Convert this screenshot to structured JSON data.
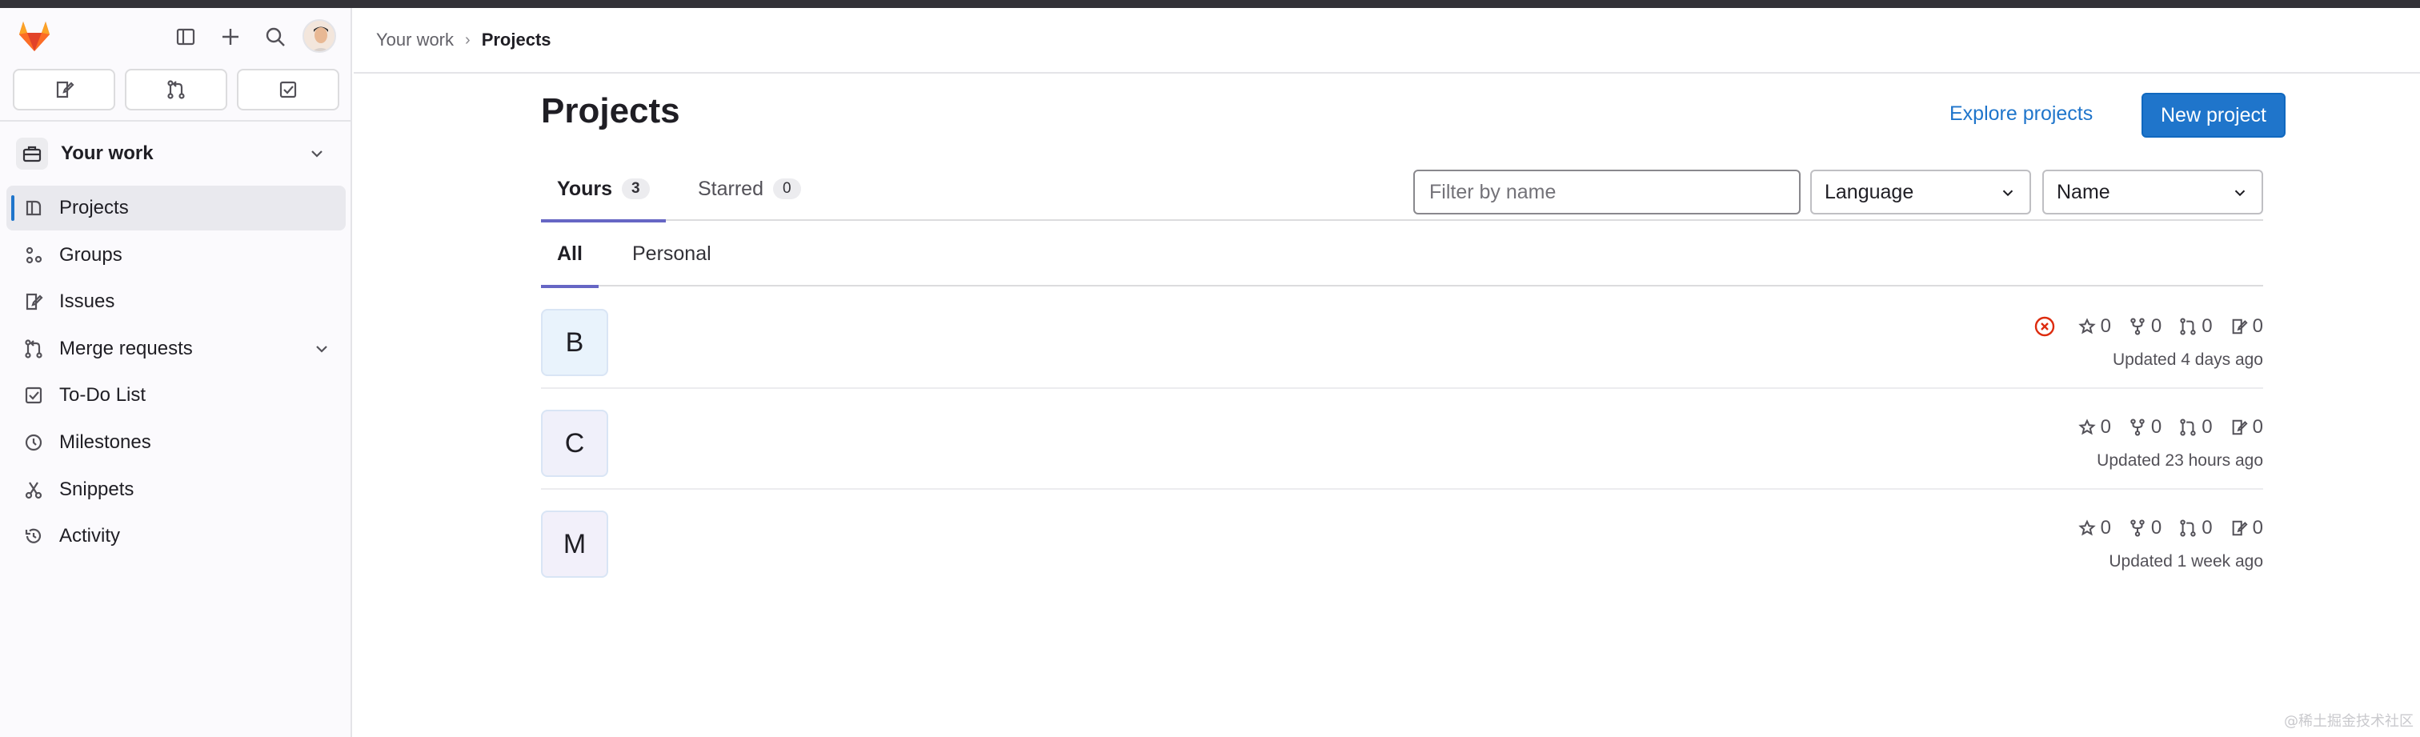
{
  "sidebar": {
    "context_label": "Your work",
    "items": [
      {
        "label": "Projects",
        "icon": "project-icon",
        "active": true
      },
      {
        "label": "Groups",
        "icon": "group-icon"
      },
      {
        "label": "Issues",
        "icon": "issues-icon"
      },
      {
        "label": "Merge requests",
        "icon": "merge-request-icon",
        "expandable": true
      },
      {
        "label": "To-Do List",
        "icon": "todo-icon"
      },
      {
        "label": "Milestones",
        "icon": "milestone-icon"
      },
      {
        "label": "Snippets",
        "icon": "snippet-icon"
      },
      {
        "label": "Activity",
        "icon": "history-icon"
      }
    ]
  },
  "breadcrumb": {
    "root": "Your work",
    "sep": "›",
    "current": "Projects"
  },
  "header": {
    "title": "Projects",
    "explore_label": "Explore projects",
    "new_label": "New project"
  },
  "tabs": [
    {
      "label": "Yours",
      "count": "3"
    },
    {
      "label": "Starred",
      "count": "0"
    }
  ],
  "filters": {
    "search_placeholder": "Filter by name",
    "language": "Language",
    "sort": "Name"
  },
  "subtabs": [
    "All",
    "Personal"
  ],
  "projects": [
    {
      "initial": "B",
      "avatar_bg": "#e9f3fc",
      "stars": "0",
      "forks": "0",
      "mrs": "0",
      "issues": "0",
      "updated": "Updated 4 days ago",
      "pipeline_failed": true
    },
    {
      "initial": "C",
      "avatar_bg": "#f0f0fa",
      "stars": "0",
      "forks": "0",
      "mrs": "0",
      "issues": "0",
      "updated": "Updated 23 hours ago"
    },
    {
      "initial": "M",
      "avatar_bg": "#f2f0fa",
      "stars": "0",
      "forks": "0",
      "mrs": "0",
      "issues": "0",
      "updated": "Updated 1 week ago"
    }
  ],
  "watermark": "@稀土掘金技术社区",
  "colors": {
    "accent": "#1f75cb",
    "tab_underline": "#6666c4",
    "failed": "#dd2b0e"
  }
}
